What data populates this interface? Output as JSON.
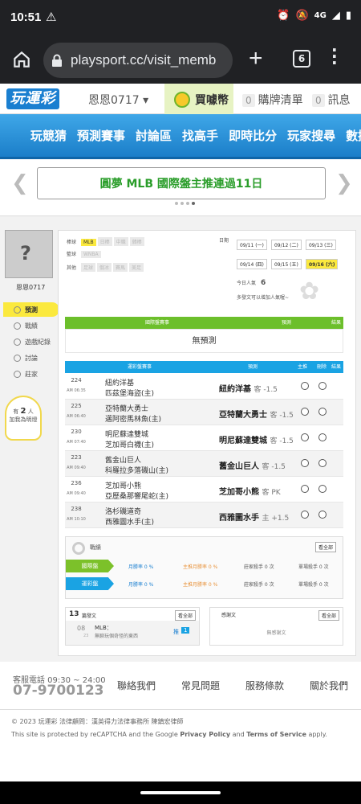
{
  "status_bar": {
    "time": "10:51",
    "net": "4G"
  },
  "browser": {
    "url": "playsport.cc/visit_memb",
    "tab_count": "6"
  },
  "site": {
    "logo": "玩運彩",
    "username": "恩恩0717 ▾",
    "buy_coin": "買噱幣",
    "purchase_count": "0",
    "purchase": "購牌清單",
    "msg_count": "0",
    "msg": "訊息"
  },
  "nav": [
    "玩競猜",
    "預測賽事",
    "討論區",
    "找高手",
    "即時比分",
    "玩家搜尋",
    "數據"
  ],
  "banner": "圓夢 MLB 國際盤主推連過11日",
  "profile": {
    "name": "恩恩0717",
    "menu": [
      "預測",
      "戰績",
      "遊戲紀錄",
      "討論",
      "莊家"
    ],
    "helper_pre": "有",
    "helper_num": "2",
    "helper_post": "人",
    "helper_sub": "加我為明燈"
  },
  "filters": {
    "baseball_label": "棒球",
    "baseball": [
      "MLB",
      "日棒",
      "中職",
      "韓棒"
    ],
    "basketball_label": "籃球",
    "basketball": [
      "WNBA"
    ],
    "other_label": "其他",
    "other": [
      "足球",
      "俄冰",
      "賽馬",
      "美足"
    ],
    "date_label": "日期",
    "dates": [
      "09/11 (一)",
      "09/12 (二)",
      "09/13 (三)",
      "09/14 (四)",
      "09/15 (五)",
      "09/16 (六)"
    ],
    "popularity_label": "今日人氣",
    "popularity": "6",
    "popularity_hint": "多發文可以增加人氣喔~"
  },
  "intl_table": {
    "headers": [
      "國際盤賽事",
      "預測",
      "結果"
    ],
    "empty": "無預測"
  },
  "tw_table": {
    "headers": [
      "運彩盤賽事",
      "預測",
      "主推",
      "刪除",
      "結果"
    ],
    "rows": [
      {
        "no": "224",
        "time": "AM 06:35",
        "home": "紐約洋基",
        "away": "匹茲堡海盜(主)",
        "pick": "紐約洋基",
        "line": "客 -1.5"
      },
      {
        "no": "225",
        "time": "AM 06:40",
        "home": "亞特蘭大勇士",
        "away": "邁阿密馬林魚(主)",
        "pick": "亞特蘭大勇士",
        "line": "客 -1.5"
      },
      {
        "no": "230",
        "time": "AM 07:40",
        "home": "明尼蘇達雙城",
        "away": "芝加哥白襪(主)",
        "pick": "明尼蘇達雙城",
        "line": "客 -1.5"
      },
      {
        "no": "223",
        "time": "AM 09:40",
        "home": "舊金山巨人",
        "away": "科羅拉多落磯山(主)",
        "pick": "舊金山巨人",
        "line": "客 -1.5"
      },
      {
        "no": "236",
        "time": "AM 09:40",
        "home": "芝加哥小熊",
        "away": "亞歷桑那響尾蛇(主)",
        "pick": "芝加哥小熊",
        "line": "客 PK"
      },
      {
        "no": "238",
        "time": "AM 10:10",
        "home": "洛杉磯道奇",
        "away": "西雅圖水手(主)",
        "pick": "西雅圖水手",
        "line": "主 +1.5"
      }
    ]
  },
  "record": {
    "title": "戰績",
    "more": "看全部",
    "rows": [
      {
        "label": "國際盤",
        "color": "#7cc12a",
        "stats": [
          "月勝率 0 %",
          "主推月勝率 0 %",
          "莊家殺手 0 次",
          "單場殺手 0 次"
        ]
      },
      {
        "label": "運彩盤",
        "color": "#1aa3e3",
        "stats": [
          "月勝率 0 %",
          "主推月勝率 0 %",
          "莊家殺手 0 次",
          "單場殺手 0 次"
        ]
      }
    ]
  },
  "posts": {
    "count": "13",
    "label": "篇發文",
    "more": "看全部",
    "item_day": "08",
    "item_sub": "23",
    "item_title": "MLB：",
    "item_desc": "無聊玩個奇怪的東西",
    "item_push": "推",
    "item_push_count": "1"
  },
  "thanks": {
    "title": "感謝文",
    "more": "看全部",
    "empty": "無感謝文"
  },
  "footer": {
    "hotline_label": "客服電話 09:30 ~ 24:00",
    "hotline": "07-9700123",
    "links": [
      "聯絡我們",
      "常見問題",
      "服務條款",
      "關於我們"
    ],
    "copyright": "© 2023 玩運彩 法律顧問：漢英得力法律事務所 陳鎮宏律師",
    "recaptcha_pre": "This site is protected by reCAPTCHA and the Google ",
    "privacy": "Privacy Policy",
    "and": " and ",
    "terms": "Terms of Service",
    "apply": " apply."
  }
}
